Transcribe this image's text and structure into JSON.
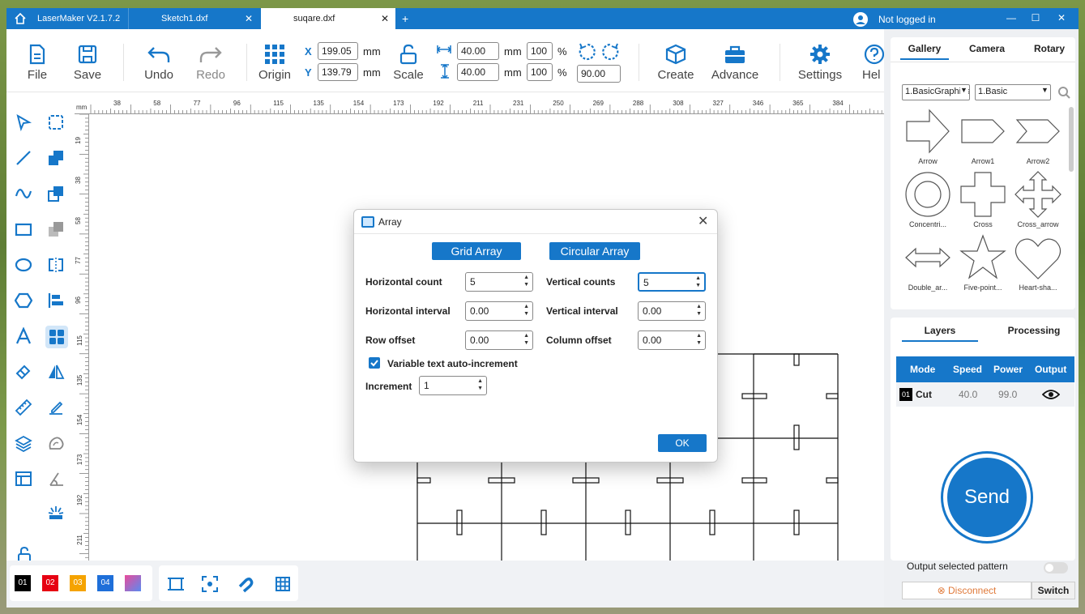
{
  "titlebar": {
    "tabs": [
      {
        "label": "LaserMaker V2.1.7.2"
      },
      {
        "label": "Sketch1.dxf"
      },
      {
        "label": "suqare.dxf"
      }
    ],
    "add_tab": "+",
    "user": "Not logged in",
    "minimize": "—",
    "maximize": "☐",
    "close": "✕"
  },
  "toolbar": {
    "file": "File",
    "save": "Save",
    "undo": "Undo",
    "redo": "Redo",
    "origin": "Origin",
    "x_label": "X",
    "y_label": "Y",
    "x_value": "199.05",
    "y_value": "139.79",
    "unit": "mm",
    "scale": "Scale",
    "width": "40.00",
    "height": "40.00",
    "width_pct": "100",
    "height_pct": "100",
    "pct": "%",
    "rotation": "90.00",
    "create": "Create",
    "advance": "Advance",
    "settings": "Settings",
    "help": "Hel"
  },
  "ruler": {
    "unit": "mm",
    "top_ticks": [
      "38",
      "58",
      "77",
      "96",
      "115",
      "135",
      "154",
      "173",
      "192",
      "211",
      "231",
      "250",
      "269",
      "288",
      "308",
      "327",
      "346",
      "365",
      "384"
    ],
    "left_ticks": [
      "19",
      "38",
      "58",
      "77",
      "96",
      "115",
      "135",
      "154",
      "173",
      "192",
      "211"
    ]
  },
  "bottombar": {
    "colors": [
      {
        "label": "01",
        "color": "#000000"
      },
      {
        "label": "02",
        "color": "#e60012"
      },
      {
        "label": "03",
        "color": "#f5a300"
      },
      {
        "label": "04",
        "color": "#1e6fd9"
      }
    ]
  },
  "rightpanel": {
    "tabs": [
      "Gallery",
      "Camera",
      "Rotary"
    ],
    "category": "1.BasicGraphics",
    "subcategory": "1.Basic",
    "shapes": [
      "Arrow",
      "Arrow1",
      "Arrow2",
      "Concentri...",
      "Cross",
      "Cross_arrow",
      "Double_ar...",
      "Five-point...",
      "Heart-sha..."
    ],
    "layer_tabs": [
      "Layers",
      "Processing"
    ],
    "layer_headers": [
      "Mode",
      "Speed",
      "Power",
      "Output"
    ],
    "layer_row": {
      "num": "01",
      "mode": "Cut",
      "speed": "40.0",
      "power": "99.0"
    },
    "send": "Send",
    "output_selected": "Output selected pattern",
    "disconnect": "Disconnect",
    "switch": "Switch"
  },
  "dialog": {
    "title": "Array",
    "grid_array": "Grid Array",
    "circular_array": "Circular Array",
    "horizontal_count_label": "Horizontal count",
    "horizontal_count": "5",
    "vertical_counts_label": "Vertical counts",
    "vertical_counts": "5",
    "horizontal_interval_label": "Horizontal interval",
    "horizontal_interval": "0.00",
    "vertical_interval_label": "Vertical interval",
    "vertical_interval": "0.00",
    "row_offset_label": "Row offset",
    "row_offset": "0.00",
    "column_offset_label": "Column offset",
    "column_offset": "0.00",
    "variable_text_label": "Variable text auto-increment",
    "variable_text_checked": true,
    "increment_label": "Increment",
    "increment": "1",
    "ok": "OK"
  },
  "colors": {
    "accent": "#1677c9"
  }
}
